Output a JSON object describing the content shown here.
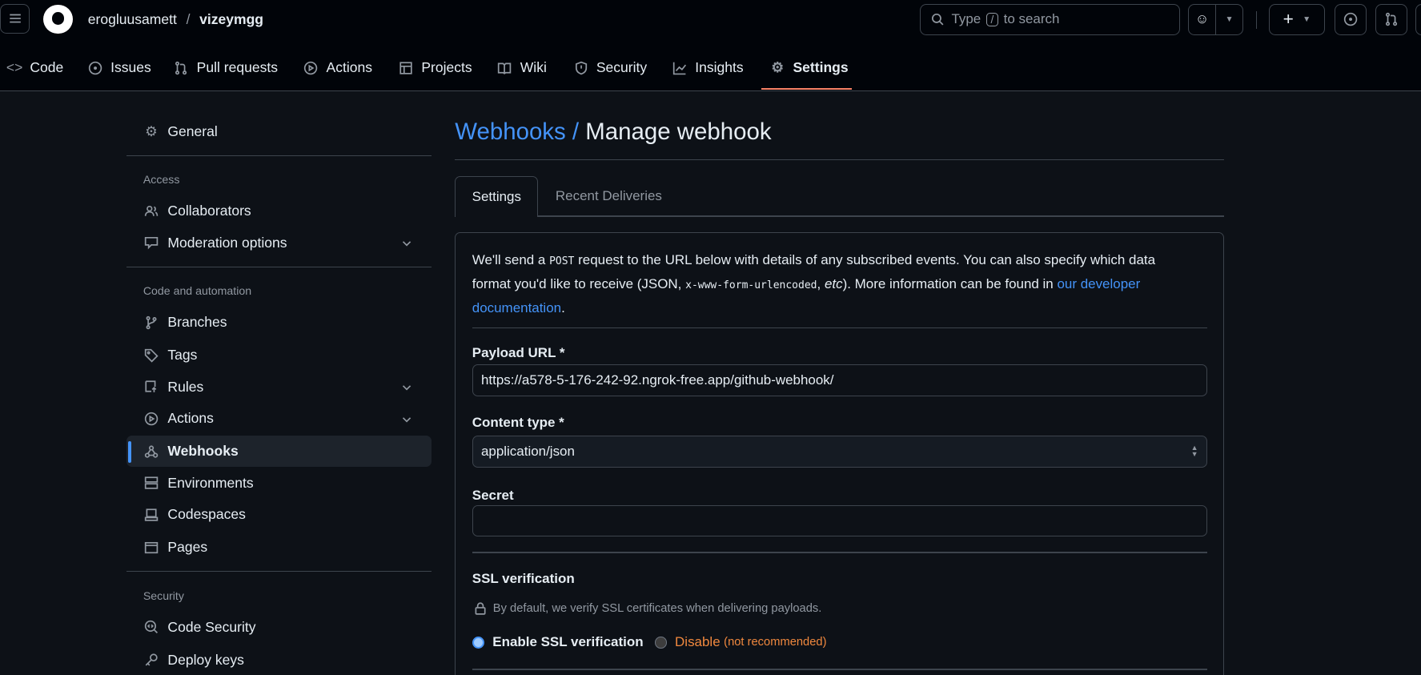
{
  "header": {
    "owner": "erogluusamett",
    "separator": "/",
    "repo": "vizeymgg",
    "search_prefix": "Type",
    "search_key": "/",
    "search_suffix": "to search"
  },
  "nav": [
    {
      "label": "Code"
    },
    {
      "label": "Issues"
    },
    {
      "label": "Pull requests"
    },
    {
      "label": "Actions"
    },
    {
      "label": "Projects"
    },
    {
      "label": "Wiki"
    },
    {
      "label": "Security"
    },
    {
      "label": "Insights"
    },
    {
      "label": "Settings"
    }
  ],
  "sidebar": {
    "general": "General",
    "access_heading": "Access",
    "collaborators": "Collaborators",
    "moderation": "Moderation options",
    "code_heading": "Code and automation",
    "branches": "Branches",
    "tags": "Tags",
    "rules": "Rules",
    "actions": "Actions",
    "webhooks": "Webhooks",
    "environments": "Environments",
    "codespaces": "Codespaces",
    "pages": "Pages",
    "security_heading": "Security",
    "code_security": "Code Security",
    "deploy_keys": "Deploy keys"
  },
  "main": {
    "breadcrumb_link": "Webhooks /",
    "title": "Manage webhook",
    "tabs": [
      "Settings",
      "Recent Deliveries"
    ],
    "intro": {
      "p1": "We'll send a ",
      "post": "POST",
      "p2": " request to the URL below with details of any subscribed events. You can also specify which data format you'd like to receive (JSON, ",
      "encoded": "x-www-form-urlencoded",
      "p3": ", ",
      "etc": "etc",
      "p4": "). More information can be found in ",
      "link": "our developer documentation",
      "p5": "."
    },
    "payload_label": "Payload URL *",
    "payload_value": "https://a578-5-176-242-92.ngrok-free.app/github-webhook/",
    "content_label": "Content type *",
    "content_value": "application/json",
    "secret_label": "Secret",
    "secret_value": "",
    "ssl_label": "SSL verification",
    "ssl_note": "By default, we verify SSL certificates when delivering payloads.",
    "ssl_enable": "Enable SSL verification",
    "ssl_disable": "Disable",
    "ssl_disable_note": "(not recommended)"
  },
  "colors": {
    "accent": "#f78166",
    "link": "#4493f8",
    "warn": "#f0883e",
    "bg": "#0d1117"
  }
}
